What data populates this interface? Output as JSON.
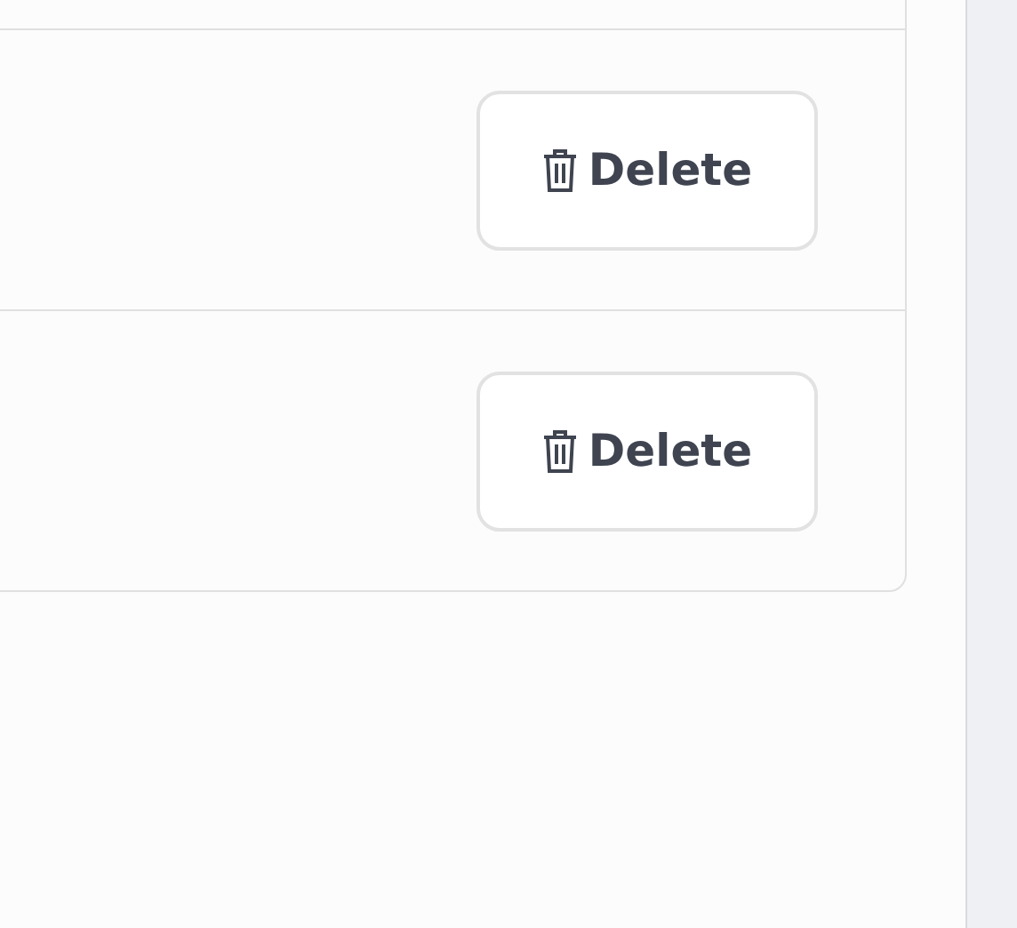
{
  "rows": [
    {
      "action": {
        "label": "Delete"
      }
    },
    {
      "action": {
        "label": "Delete"
      }
    }
  ]
}
